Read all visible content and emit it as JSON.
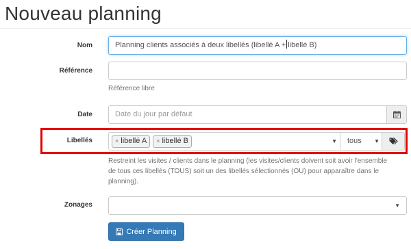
{
  "page": {
    "title": "Nouveau planning"
  },
  "form": {
    "nom": {
      "label": "Nom",
      "value_before": "Planning clients associés à deux libellés (libellé A +",
      "value_after": "libellé B)"
    },
    "reference": {
      "label": "Référence",
      "value": "",
      "help": "Référence libre"
    },
    "date": {
      "label": "Date",
      "placeholder": "Date du jour par défaut",
      "icon": "calendar-icon"
    },
    "libelles": {
      "label": "Libellés",
      "tags": [
        "libellé A",
        "libellé B"
      ],
      "tag_remove": "×",
      "mode": "tous",
      "icon": "tags-icon",
      "help": "Restreint les visites / clients dans le planning (les visites/clients doivent soit avoir l'ensemble de tous ces libellés (TOUS) soit un des libellés sélectionnés (OU) pour apparaître dans le planning)."
    },
    "zonages": {
      "label": "Zonages",
      "value": ""
    },
    "submit": {
      "label": "Créer Planning",
      "icon": "save-icon"
    }
  },
  "colors": {
    "primary": "#337ab7",
    "highlight": "#e60000",
    "focus": "#66afe9"
  }
}
